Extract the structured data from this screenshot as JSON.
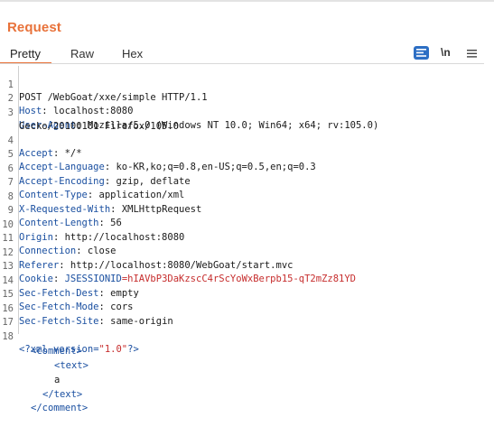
{
  "panel": {
    "title": "Request"
  },
  "tabs": [
    {
      "label": "Pretty",
      "active": true
    },
    {
      "label": "Raw",
      "active": false
    },
    {
      "label": "Hex",
      "active": false
    }
  ],
  "toolbar": {
    "format_icon": "list-format-icon",
    "newline_label": "\\n",
    "menu_icon": "hamburger-menu-icon"
  },
  "request": {
    "line1": "POST /WebGoat/xxe/simple HTTP/1.1",
    "headers": [
      {
        "name": "Host",
        "value": "localhost:8080"
      },
      {
        "name": "User-Agent",
        "value": "Mozilla/5.0 (Windows NT 10.0; Win64; x64; rv:105.0)"
      },
      {
        "name": "",
        "value": "Gecko/20100101 Firefox/105.0"
      },
      {
        "name": "Accept",
        "value": "*/*"
      },
      {
        "name": "Accept-Language",
        "value": "ko-KR,ko;q=0.8,en-US;q=0.5,en;q=0.3"
      },
      {
        "name": "Accept-Encoding",
        "value": "gzip, deflate"
      },
      {
        "name": "Content-Type",
        "value": "application/xml"
      },
      {
        "name": "X-Requested-With",
        "value": "XMLHttpRequest"
      },
      {
        "name": "Content-Length",
        "value": "56"
      },
      {
        "name": "Origin",
        "value": "http://localhost:8080"
      },
      {
        "name": "Connection",
        "value": "close"
      },
      {
        "name": "Referer",
        "value": "http://localhost:8080/WebGoat/start.mvc"
      }
    ],
    "cookie": {
      "name": "Cookie",
      "key": "JSESSIONID",
      "eq": "=",
      "value": "hIAVbP3DaKzscC4rScYoWxBerpb15-qT2mZz81YD"
    },
    "headers2": [
      {
        "name": "Sec-Fetch-Dest",
        "value": "empty"
      },
      {
        "name": "Sec-Fetch-Mode",
        "value": "cors"
      },
      {
        "name": "Sec-Fetch-Site",
        "value": "same-origin"
      }
    ],
    "xml_decl": {
      "open": "<?xml",
      "attr": "version=",
      "val": "\"1.0\"",
      "close": "?>"
    },
    "xml_lines": [
      "<comment>",
      "<text>",
      "a",
      "</text>",
      "</comment>"
    ]
  },
  "line_numbers": [
    "1",
    "2",
    "3",
    "",
    "4",
    "5",
    "6",
    "7",
    "8",
    "9",
    "10",
    "11",
    "12",
    "13",
    "14",
    "15",
    "16",
    "17",
    "18"
  ]
}
